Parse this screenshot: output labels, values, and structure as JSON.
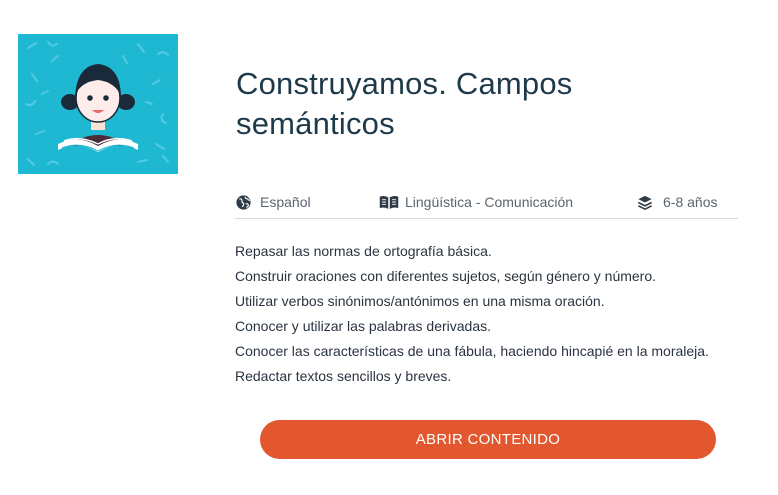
{
  "content": {
    "title": "Construyamos. Campos semánticos",
    "thumbnail_icon": "child-reading-book-illustration",
    "meta": {
      "language": {
        "icon": "globe-icon",
        "label": "Español"
      },
      "subject": {
        "icon": "open-book-icon",
        "label": "Lingüística - Comunicación"
      },
      "age": {
        "icon": "layers-icon",
        "label": "6-8 años"
      }
    },
    "objectives": [
      "Repasar las normas de ortografía básica.",
      "Construir oraciones con diferentes sujetos, según género y número.",
      "Utilizar verbos sinónimos/antónimos en una misma oración.",
      "Conocer y utilizar las palabras derivadas.",
      "Conocer las características de una fábula, haciendo hincapié en la moraleja.",
      "Redactar textos sencillos y breves."
    ],
    "open_button_label": "ABRIR CONTENIDO"
  },
  "colors": {
    "thumbnail_bg": "#1fb8d3",
    "title": "#1e3a4a",
    "button": "#e2572d"
  }
}
